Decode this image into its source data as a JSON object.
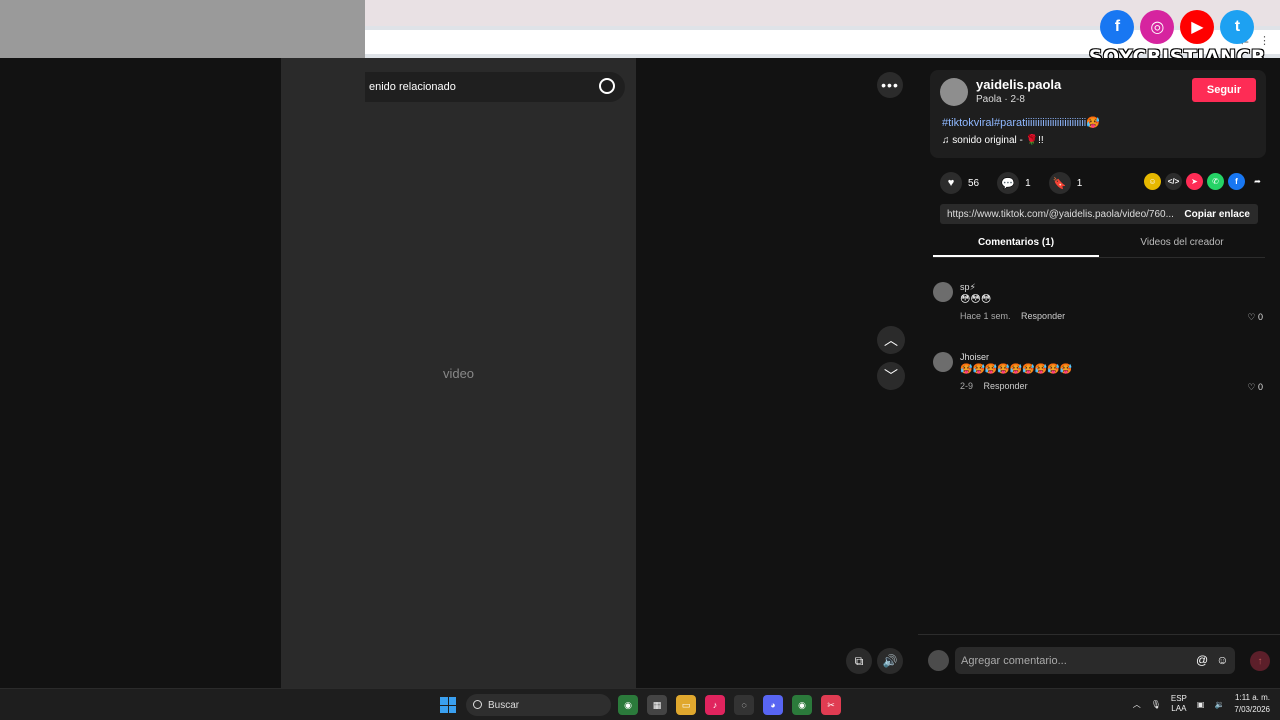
{
  "overlay": {
    "brand": "SOYCRISTIANCR",
    "social_icons": [
      {
        "name": "facebook-icon",
        "glyph": "f",
        "color": "#1877f2"
      },
      {
        "name": "instagram-icon",
        "glyph": "◎",
        "color": "#d6249f"
      },
      {
        "name": "youtube-icon",
        "glyph": "▶",
        "color": "#ff0000"
      },
      {
        "name": "twitter-icon",
        "glyph": "🐦",
        "color": "#1da1f2"
      }
    ]
  },
  "video": {
    "related_search": "enido relacionado",
    "more_glyph": "•••"
  },
  "post": {
    "username": "yaidelis.paola",
    "subline": "Paola · 2-8",
    "follow_label": "Seguir",
    "hashtags": "#tiktokviral#paratiiiiiiiiiiiiiiiiiiiiiiiii🥵",
    "sound": "♫  sonido original - 🌹!!",
    "likes": "56",
    "comments": "1",
    "saves": "1",
    "link": "https://www.tiktok.com/@yaidelis.paola/video/760...",
    "copy_label": "Copiar enlace"
  },
  "tabs": {
    "comments": "Comentarios (1)",
    "creator": "Videos del creador"
  },
  "comments": [
    {
      "user": "sp⚡",
      "text": "😳😳😳",
      "time": "Hace 1 sem.",
      "reply": "Responder",
      "likes": "♡ 0"
    },
    {
      "user": "Jhoiser",
      "text": "🥵🥵🥵🥵🥵🥵🥵🥵🥵",
      "time": "2-9",
      "reply": "Responder",
      "likes": "♡ 0"
    }
  ],
  "comment_input": {
    "placeholder": "Agregar comentario..."
  },
  "taskbar": {
    "search": "Buscar",
    "lang_top": "ESP",
    "lang_bottom": "LAA",
    "time": "1:11 a. m.",
    "date": "7/03/2026"
  }
}
